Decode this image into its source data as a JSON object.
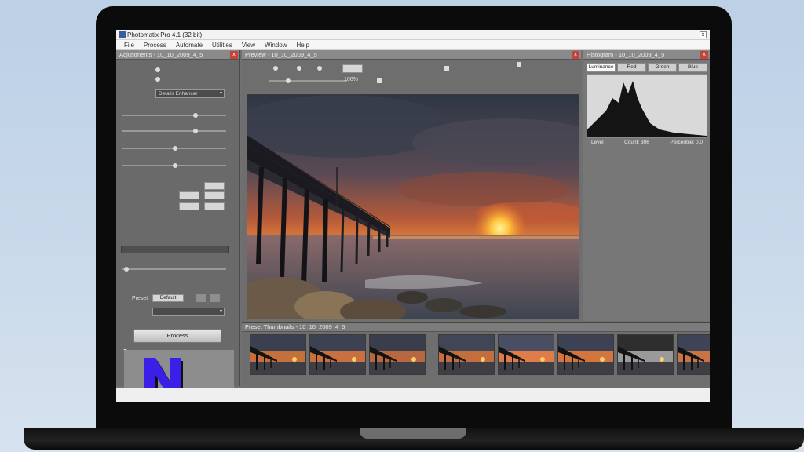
{
  "window": {
    "title": "Photomatix Pro 4.1 (32 bit)",
    "close_glyph": "x"
  },
  "menu": [
    "File",
    "Process",
    "Automate",
    "Utilities",
    "View",
    "Window",
    "Help"
  ],
  "adjustments": {
    "panel_title": "Adjustments - 10_10_2009_4_5",
    "close_glyph": "x",
    "process_label": "Process",
    "preset_label": "Preset",
    "preset_value": "Default",
    "style_value": "Details Enhancer"
  },
  "preview": {
    "panel_title": "Preview - 10_10_2009_4_5",
    "close_glyph": "x",
    "zoom_value": "100%"
  },
  "histogram": {
    "panel_title": "Histogram - 10_10_2009_4_5",
    "close_glyph": "x",
    "tabs": [
      "Luminance",
      "Red",
      "Green",
      "Blue"
    ],
    "readout": [
      "Level",
      "Count: 306",
      "Percentile: 0.0"
    ]
  },
  "filmstrip": {
    "title": "Preset Thumbnails - 10_10_2009_4_5"
  },
  "colors": {
    "panel": "#6a6a6a",
    "accent_logo": "#3a1fe8"
  },
  "icons": {
    "logo": "letter-n-logo-icon"
  }
}
